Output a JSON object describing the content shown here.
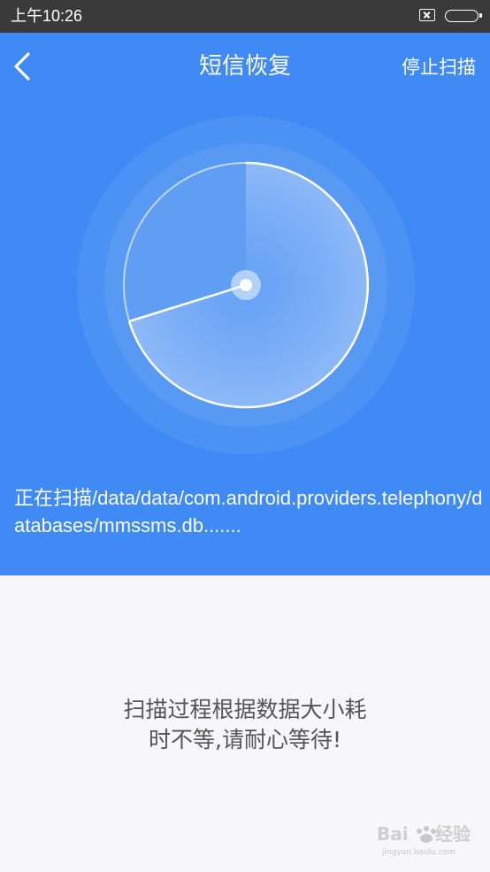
{
  "status_bar": {
    "time": "上午10:26",
    "icons": [
      "sim-card-x-icon",
      "battery-icon"
    ]
  },
  "header": {
    "back_icon": "chevron-left-icon",
    "title": "短信恢复",
    "stop_button_label": "停止扫描"
  },
  "scan": {
    "path_text": "正在扫描/data/data/com.android.providers.telephony/databases/mmssms.db......."
  },
  "message": {
    "line1": "扫描过程根据数据大小耗",
    "line2": "时不等,请耐心等待!"
  },
  "watermark": {
    "text": "Baidu 经验",
    "sub": "jingyan.baidu.com"
  },
  "colors": {
    "primary": "#3f8af4",
    "status_bar": "#3a3a3a",
    "background": "#f7f7f9",
    "message_text": "#555555"
  }
}
